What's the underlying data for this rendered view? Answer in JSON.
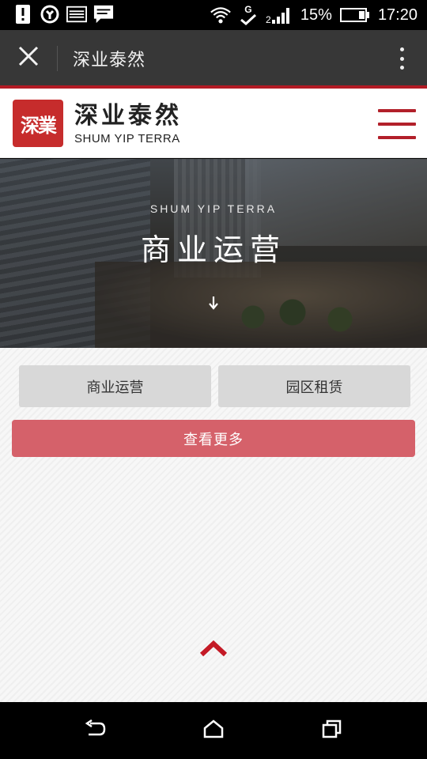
{
  "status_bar": {
    "icons": [
      "alert-icon",
      "sync-icon",
      "image-icon",
      "message-icon",
      "wifi-icon",
      "signal-g-icon",
      "signal-bars-icon",
      "battery-icon"
    ],
    "battery_percent": "15%",
    "time": "17:20",
    "network_type": "G"
  },
  "title_bar": {
    "title": "深业泰然",
    "close_icon": "close-icon",
    "more_icon": "more-vertical-icon"
  },
  "header": {
    "logo_seal_text": "深業",
    "logo_name": "深业泰然",
    "logo_english": "SHUM YIP TERRA",
    "menu_icon": "hamburger-menu-icon",
    "accent_color": "#b2202a"
  },
  "hero": {
    "subtitle": "SHUM YIP TERRA",
    "title": "商业运营",
    "arrow_icon": "arrow-down-icon"
  },
  "content": {
    "buttons": [
      {
        "label": "商业运营"
      },
      {
        "label": "园区租赁"
      }
    ],
    "more_label": "查看更多",
    "more_color": "#d5616a",
    "back_to_top_icon": "chevron-up-icon"
  },
  "nav_bar": {
    "icons": [
      "back-icon",
      "home-icon",
      "recent-apps-icon"
    ]
  }
}
